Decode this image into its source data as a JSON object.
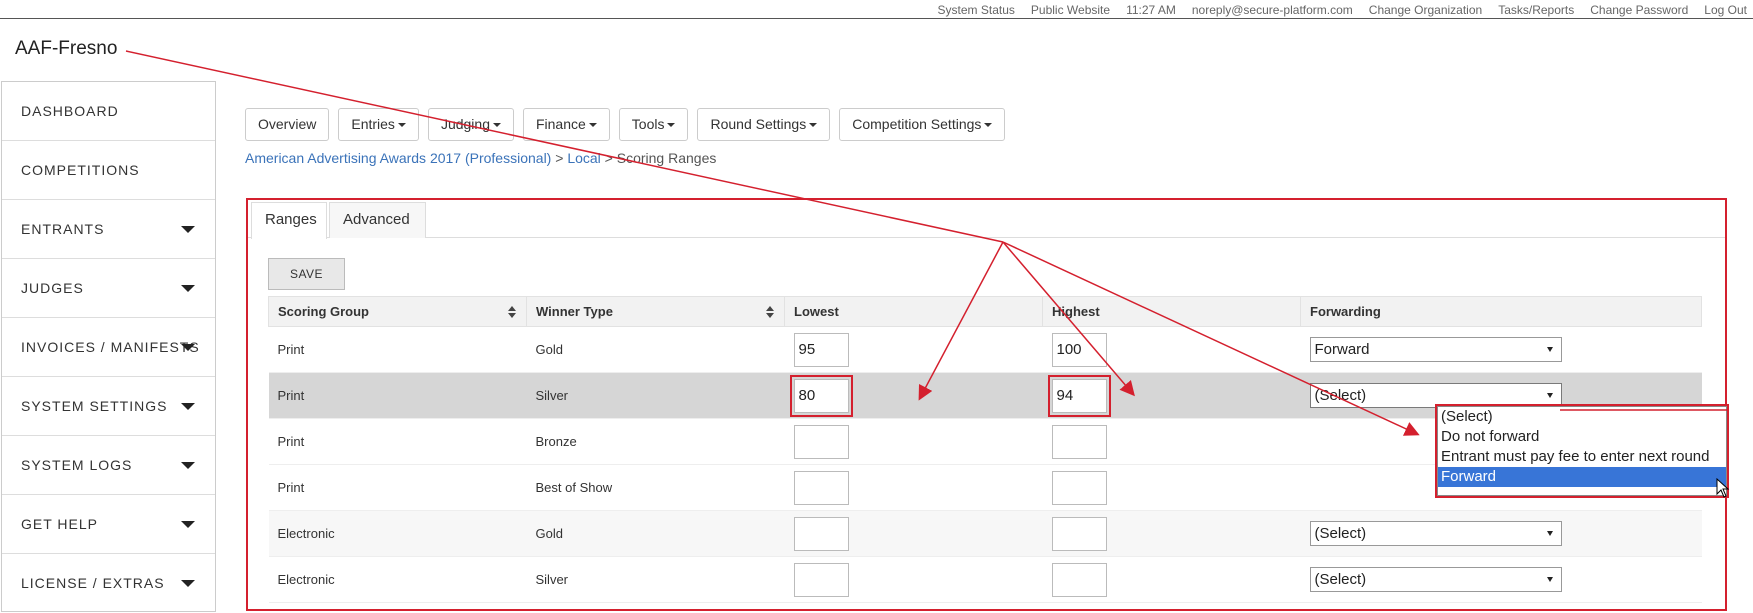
{
  "topbar": {
    "links": [
      "System Status",
      "Public Website",
      "11:27 AM",
      "noreply@secure-platform.com",
      "Change Organization",
      "Tasks/Reports",
      "Change Password",
      "Log Out"
    ]
  },
  "org_title": "AAF-Fresno",
  "sidebar": {
    "items": [
      {
        "label": "Dashboard",
        "caret": false
      },
      {
        "label": "Competitions",
        "caret": false
      },
      {
        "label": "Entrants",
        "caret": true
      },
      {
        "label": "Judges",
        "caret": true
      },
      {
        "label": "Invoices / Manifests",
        "caret": true
      },
      {
        "label": "System Settings",
        "caret": true
      },
      {
        "label": "System Logs",
        "caret": true
      },
      {
        "label": "Get Help",
        "caret": true
      },
      {
        "label": "License / Extras",
        "caret": true
      }
    ]
  },
  "nav": {
    "buttons": [
      {
        "label": "Overview",
        "caret": false
      },
      {
        "label": "Entries",
        "caret": true
      },
      {
        "label": "Judging",
        "caret": true
      },
      {
        "label": "Finance",
        "caret": true
      },
      {
        "label": "Tools",
        "caret": true
      },
      {
        "label": "Round Settings",
        "caret": true
      },
      {
        "label": "Competition Settings",
        "caret": true
      }
    ]
  },
  "breadcrumb": {
    "competition": "American Advertising Awards 2017 (Professional)",
    "sep1": " > ",
    "round": "Local",
    "sep2": " > ",
    "page": "Scoring Ranges"
  },
  "tabs": {
    "active": "Ranges",
    "inactive": "Advanced"
  },
  "save_label": "SAVE",
  "table": {
    "headers": [
      "Scoring Group",
      "Winner Type",
      "Lowest",
      "Highest",
      "Forwarding"
    ],
    "rows": [
      {
        "group": "Print",
        "winner": "Gold",
        "lowest": "95",
        "highest": "100",
        "forwarding": "Forward"
      },
      {
        "group": "Print",
        "winner": "Silver",
        "lowest": "80",
        "highest": "94",
        "forwarding": "(Select)"
      },
      {
        "group": "Print",
        "winner": "Bronze",
        "lowest": "",
        "highest": "",
        "forwarding": ""
      },
      {
        "group": "Print",
        "winner": "Best of Show",
        "lowest": "",
        "highest": "",
        "forwarding": ""
      },
      {
        "group": "Electronic",
        "winner": "Gold",
        "lowest": "",
        "highest": "",
        "forwarding": "(Select)"
      },
      {
        "group": "Electronic",
        "winner": "Silver",
        "lowest": "",
        "highest": "",
        "forwarding": "(Select)"
      }
    ]
  },
  "dropdown": {
    "options": [
      "(Select)",
      "Do not forward",
      "Entrant must pay fee to enter next round",
      "Forward"
    ],
    "highlighted": "Forward"
  },
  "colors": {
    "annotation": "#d4202e",
    "link": "#3b73b9",
    "highlight": "#3875d7"
  }
}
